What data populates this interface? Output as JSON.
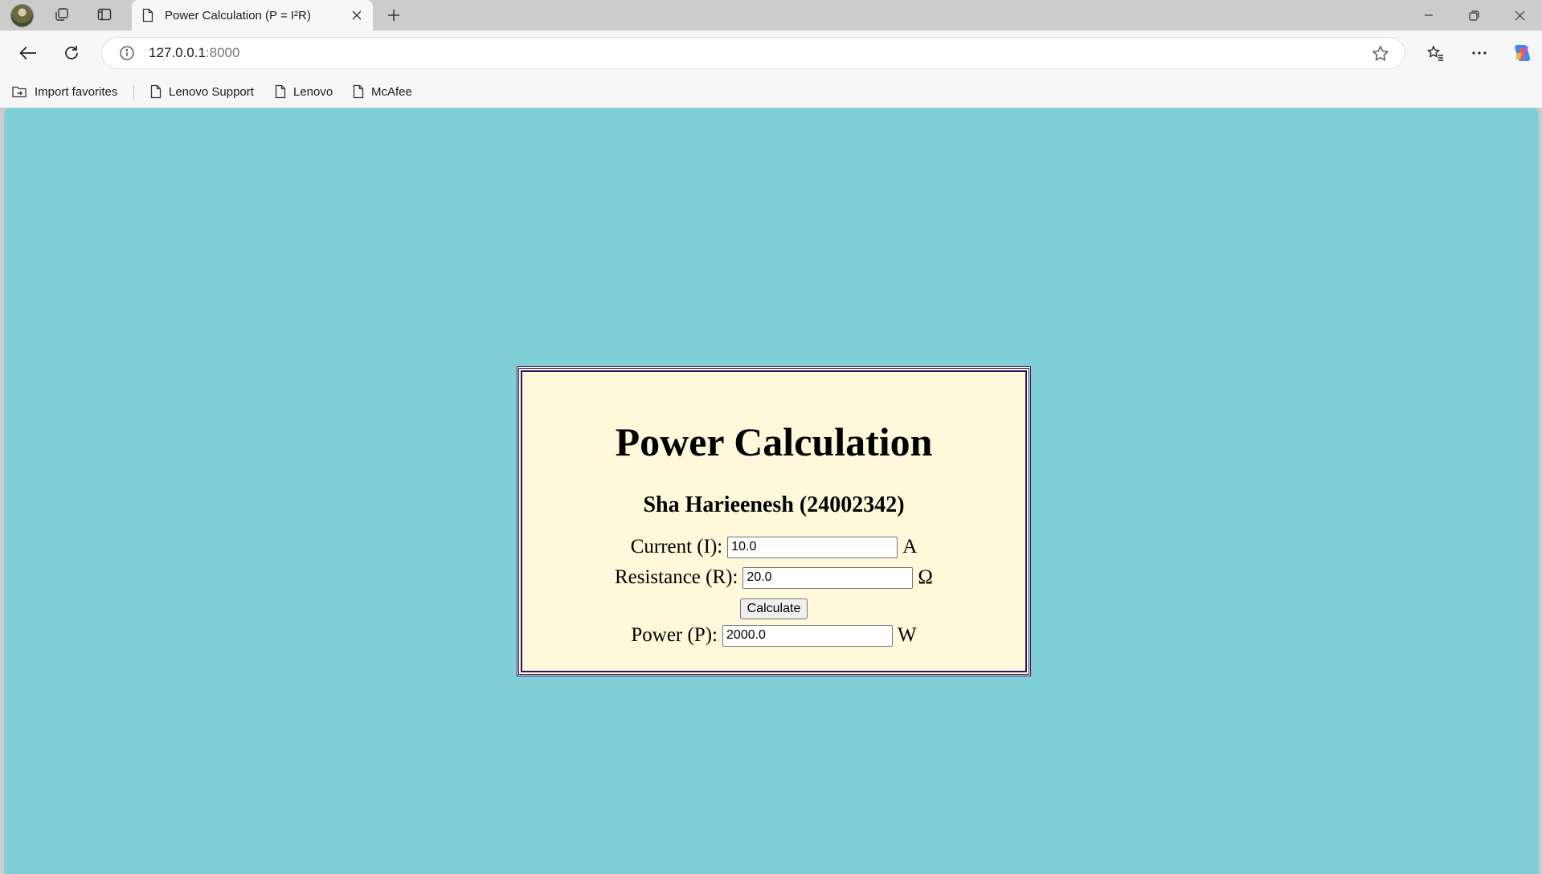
{
  "browser": {
    "tab_title": "Power Calculation (P = I²R)",
    "url_host": "127.0.0.1",
    "url_port": ":8000",
    "favorites": [
      {
        "label": "Import favorites",
        "icon": "import-icon"
      },
      {
        "label": "Lenovo Support",
        "icon": "page-icon"
      },
      {
        "label": "Lenovo",
        "icon": "page-icon"
      },
      {
        "label": "McAfee",
        "icon": "page-icon"
      }
    ]
  },
  "page": {
    "background": "#80ced6",
    "title": "Power Calculation",
    "subtitle": "Sha Harieenesh (24002342)",
    "current_label": "Current (I):",
    "current_value": "10.0",
    "current_unit": "A",
    "resistance_label": "Resistance (R):",
    "resistance_value": "20.0",
    "resistance_unit": "Ω",
    "button_label": "Calculate",
    "power_label": "Power (P):",
    "power_value": "2000.0",
    "power_unit": "W"
  }
}
